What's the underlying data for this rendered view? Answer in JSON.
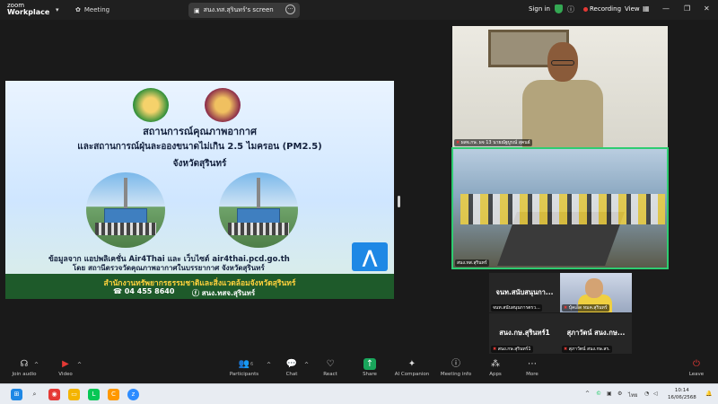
{
  "titlebar": {
    "app_line1": "zoom",
    "app_line2": "Workplace",
    "meeting_tab": "Meeting",
    "screen_tab": "สนง.ทส.สุรินทร์'s screen",
    "sign_in": "Sign in",
    "recording": "Recording",
    "view": "View"
  },
  "slide": {
    "title1": "สถานการณ์คุณภาพอากาศ",
    "title2": "และสถานการณ์ฝุ่นละอองขนาดไม่เกิน 2.5 ไมครอน (PM2.5)",
    "title3": "จังหวัดสุรินทร์",
    "source1": "ข้อมูลจาก แอปพลิเคชั่น Air4Thai และ เว็บไซต์ air4thai.pcd.go.th",
    "source2": "โดย สถานีตรวจวัดคุณภาพอากาศในบรรยากาศ จังหวัดสุรินทร์",
    "footer_org": "สำนักงานทรัพยากรธรรมชาติและสิ่งแวดล้อมจังหวัดสุรินทร์",
    "phone": "04 455 8640",
    "facebook": "สนง.ทสจ.สุรินทร์"
  },
  "participants": {
    "tile1_name": "ผสจ.กษ. ผจ 13 นายณัฐบูรณ์ สุคนธ์",
    "tile2_name": "สนง.ทส.สุรินทร์",
    "tile3_big": "จนท.สนับสนุนกา...",
    "tile3_name": "จนท.สนับสนุนการตรว...",
    "tile4_name": "บุ้คเอ็ด ทมค.สุรินทร์",
    "tile5_big": "สนง.กษ.สุรินทร์1",
    "tile5_name": "สนง.กษ.สุรินทร์1",
    "tile6_big": "สุภาวัตน์ สนง.กษ...",
    "tile6_name": "สุภาวัตน์ สนง.กษ.สร."
  },
  "toolbar": {
    "join_audio": "Join audio",
    "video": "Video",
    "participants": "Participants",
    "participants_count": "6",
    "chat": "Chat",
    "react": "React",
    "share": "Share",
    "ai_companion": "AI Companion",
    "meeting_info": "Meeting info",
    "apps": "Apps",
    "more": "More",
    "leave": "Leave"
  },
  "taskbar": {
    "lang": "ไทย",
    "time": "10:14",
    "date": "16/06/2568"
  },
  "colors": {
    "active_speaker_border": "#2ecc71",
    "recording_dot": "#e53935",
    "share_button": "#19a55b",
    "slide_footer": "#1e5a2a"
  }
}
